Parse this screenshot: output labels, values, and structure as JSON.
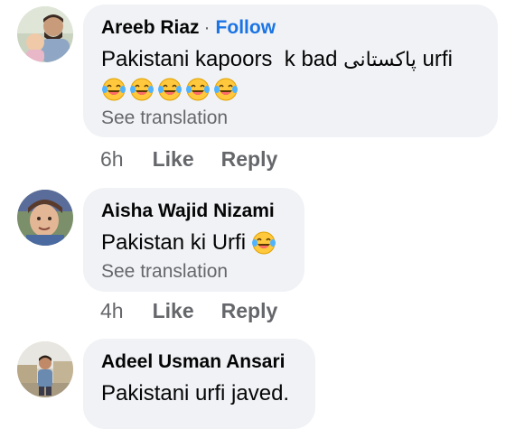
{
  "comments": [
    {
      "author": "Areeb Riaz",
      "follow": "Follow",
      "separator": "·",
      "text_before": "Pakistani kapoors  k bad ",
      "text_urdu": "پاکستانی",
      "text_after": " urfi",
      "emojis": [
        "face-with-tears-of-joy",
        "face-with-tears-of-joy",
        "face-with-tears-of-joy",
        "face-with-tears-of-joy",
        "face-with-tears-of-joy"
      ],
      "see_translation": "See translation",
      "time": "6h",
      "like": "Like",
      "reply": "Reply"
    },
    {
      "author": "Aisha Wajid Nizami",
      "text": "Pakistan ki Urfi",
      "emojis": [
        "face-with-tears-of-joy"
      ],
      "see_translation": "See translation",
      "time": "4h",
      "like": "Like",
      "reply": "Reply"
    },
    {
      "author": "Adeel Usman Ansari",
      "text": "Pakistani urfi javed."
    }
  ],
  "colors": {
    "bubble": "#f0f2f5",
    "follow": "#1b74e4",
    "meta": "#65676b",
    "text": "#050505"
  }
}
